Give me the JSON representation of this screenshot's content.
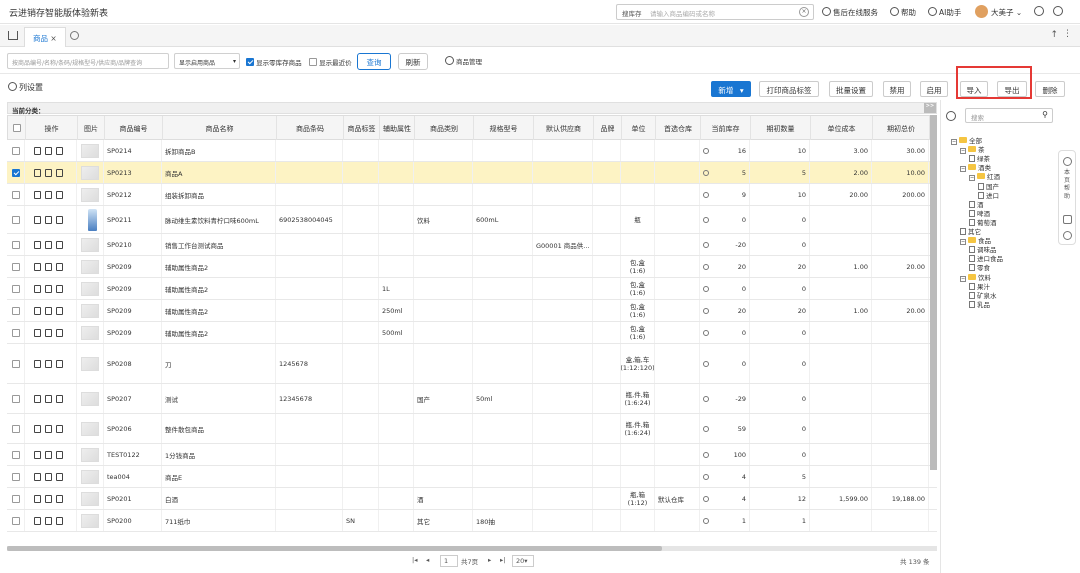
{
  "app": {
    "title": "云进销存智能版体验新表"
  },
  "search": {
    "label": "搜库存",
    "placeholder": "请输入商品编码或名称"
  },
  "topnav": {
    "service": "售后在线服务",
    "help": "帮助",
    "ai": "AI助手",
    "user": "大美子"
  },
  "tabs": [
    {
      "label": "商品"
    }
  ],
  "filter": {
    "keyword_placeholder": "按商品编号/名称/条码/规格型号/供应商/品牌查询",
    "status_select": "显示启用商品",
    "show_zero_stock": "显示零库存商品",
    "show_recent_price": "显示最近价",
    "query": "查询",
    "refresh": "刷新",
    "manage": "商品管理"
  },
  "toolbar": {
    "col_settings": "列设置",
    "new": "新增",
    "print_label": "打印商品标签",
    "batch": "批量设置",
    "disable": "禁用",
    "enable": "启用",
    "import": "导入",
    "export": "导出",
    "delete": "删除"
  },
  "category_bar": {
    "label": "当前分类：",
    "expand": ">>"
  },
  "columns": [
    "操作",
    "图片",
    "商品编号",
    "商品名称",
    "商品条码",
    "商品标签",
    "辅助属性",
    "商品类别",
    "规格型号",
    "默认供应商",
    "品牌",
    "单位",
    "首选仓库",
    "当前库存",
    "期初数量",
    "单位成本",
    "期初总价"
  ],
  "rows": [
    {
      "code": "SP0214",
      "name": "拆卸商品B",
      "barcode": "",
      "tag": "",
      "attr": "",
      "cat": "",
      "spec": "",
      "supplier": "",
      "brand": "",
      "unit": "",
      "wh": "",
      "stock": "16",
      "init": "10",
      "cost": "3.00",
      "total": "30.00"
    },
    {
      "code": "SP0213",
      "name": "商品A",
      "barcode": "",
      "tag": "",
      "attr": "",
      "cat": "",
      "spec": "",
      "supplier": "",
      "brand": "",
      "unit": "",
      "wh": "",
      "stock": "5",
      "init": "5",
      "cost": "2.00",
      "total": "10.00"
    },
    {
      "code": "SP0212",
      "name": "组装拆卸商品",
      "barcode": "",
      "tag": "",
      "attr": "",
      "cat": "",
      "spec": "",
      "supplier": "",
      "brand": "",
      "unit": "",
      "wh": "",
      "stock": "9",
      "init": "10",
      "cost": "20.00",
      "total": "200.00"
    },
    {
      "code": "SP0211",
      "name": "脉动维生素饮料青柠口味600mL",
      "barcode": "6902538004045",
      "tag": "",
      "attr": "",
      "cat": "饮料",
      "spec": "600mL",
      "supplier": "",
      "brand": "",
      "unit": "瓶",
      "wh": "",
      "stock": "0",
      "init": "0",
      "cost": "",
      "total": ""
    },
    {
      "code": "SP0210",
      "name": "销售工作台测试商品",
      "barcode": "",
      "tag": "",
      "attr": "",
      "cat": "",
      "spec": "",
      "supplier": "G00001 商品供...",
      "brand": "",
      "unit": "",
      "wh": "",
      "stock": "-20",
      "init": "0",
      "cost": "",
      "total": ""
    },
    {
      "code": "SP0209",
      "name": "辅助属性商品2",
      "barcode": "",
      "tag": "",
      "attr": "",
      "cat": "",
      "spec": "",
      "supplier": "",
      "brand": "",
      "unit": "包,盒(1:6)",
      "wh": "",
      "stock": "20",
      "init": "20",
      "cost": "1.00",
      "total": "20.00"
    },
    {
      "code": "SP0209",
      "name": "辅助属性商品2",
      "barcode": "",
      "tag": "",
      "attr": "1L",
      "cat": "",
      "spec": "",
      "supplier": "",
      "brand": "",
      "unit": "包,盒(1:6)",
      "wh": "",
      "stock": "0",
      "init": "0",
      "cost": "",
      "total": ""
    },
    {
      "code": "SP0209",
      "name": "辅助属性商品2",
      "barcode": "",
      "tag": "",
      "attr": "250ml",
      "cat": "",
      "spec": "",
      "supplier": "",
      "brand": "",
      "unit": "包,盒(1:6)",
      "wh": "",
      "stock": "20",
      "init": "20",
      "cost": "1.00",
      "total": "20.00"
    },
    {
      "code": "SP0209",
      "name": "辅助属性商品2",
      "barcode": "",
      "tag": "",
      "attr": "500ml",
      "cat": "",
      "spec": "",
      "supplier": "",
      "brand": "",
      "unit": "包,盒(1:6)",
      "wh": "",
      "stock": "0",
      "init": "0",
      "cost": "",
      "total": ""
    },
    {
      "code": "SP0208",
      "name": "刀",
      "barcode": "1245678",
      "tag": "",
      "attr": "",
      "cat": "",
      "spec": "",
      "supplier": "",
      "brand": "",
      "unit": "盒,箱,车(1:12:120)",
      "wh": "",
      "stock": "0",
      "init": "0",
      "cost": "",
      "total": ""
    },
    {
      "code": "SP0207",
      "name": "测试",
      "barcode": "12345678",
      "tag": "",
      "attr": "",
      "cat": "国产",
      "spec": "50ml",
      "supplier": "",
      "brand": "",
      "unit": "瓶,件,箱(1:6:24)",
      "wh": "",
      "stock": "-29",
      "init": "0",
      "cost": "",
      "total": ""
    },
    {
      "code": "SP0206",
      "name": "整件散包商品",
      "barcode": "",
      "tag": "",
      "attr": "",
      "cat": "",
      "spec": "",
      "supplier": "",
      "brand": "",
      "unit": "瓶,件,箱(1:6:24)",
      "wh": "",
      "stock": "59",
      "init": "0",
      "cost": "",
      "total": ""
    },
    {
      "code": "TEST0122",
      "name": "1分钱商品",
      "barcode": "",
      "tag": "",
      "attr": "",
      "cat": "",
      "spec": "",
      "supplier": "",
      "brand": "",
      "unit": "",
      "wh": "",
      "stock": "100",
      "init": "0",
      "cost": "",
      "total": ""
    },
    {
      "code": "tea004",
      "name": "商品E",
      "barcode": "",
      "tag": "",
      "attr": "",
      "cat": "",
      "spec": "",
      "supplier": "",
      "brand": "",
      "unit": "",
      "wh": "",
      "stock": "4",
      "init": "5",
      "cost": "",
      "total": ""
    },
    {
      "code": "SP0201",
      "name": "白酒",
      "barcode": "",
      "tag": "",
      "attr": "",
      "cat": "酒",
      "spec": "",
      "supplier": "",
      "brand": "",
      "unit": "瓶,箱(1:12)",
      "wh": "默认仓库",
      "stock": "4",
      "init": "12",
      "cost": "1,599.00",
      "total": "19,188.00"
    },
    {
      "code": "SP0200",
      "name": "711纸巾",
      "barcode": "",
      "tag": "SN",
      "attr": "",
      "cat": "其它",
      "spec": "180抽",
      "supplier": "",
      "brand": "",
      "unit": "",
      "wh": "",
      "stock": "1",
      "init": "1",
      "cost": "",
      "total": ""
    }
  ],
  "pager": {
    "page": "1",
    "of": "共7页",
    "size": "20",
    "total": "共 139 条"
  },
  "tree": {
    "search_placeholder": "搜索",
    "nodes": [
      {
        "label": "全部",
        "lvl": 0,
        "folder": true
      },
      {
        "label": "茶",
        "lvl": 1,
        "folder": true
      },
      {
        "label": "绿茶",
        "lvl": 2,
        "folder": false
      },
      {
        "label": "酒类",
        "lvl": 1,
        "folder": true
      },
      {
        "label": "红酒",
        "lvl": 2,
        "folder": true
      },
      {
        "label": "国产",
        "lvl": 3,
        "folder": false
      },
      {
        "label": "进口",
        "lvl": 3,
        "folder": false
      },
      {
        "label": "酒",
        "lvl": 2,
        "folder": false
      },
      {
        "label": "啤酒",
        "lvl": 2,
        "folder": false
      },
      {
        "label": "葡萄酒",
        "lvl": 2,
        "folder": false
      },
      {
        "label": "其它",
        "lvl": 1,
        "folder": false
      },
      {
        "label": "食品",
        "lvl": 1,
        "folder": true
      },
      {
        "label": "调味品",
        "lvl": 2,
        "folder": false
      },
      {
        "label": "进口食品",
        "lvl": 2,
        "folder": false
      },
      {
        "label": "零食",
        "lvl": 2,
        "folder": false
      },
      {
        "label": "饮料",
        "lvl": 1,
        "folder": true
      },
      {
        "label": "果汁",
        "lvl": 2,
        "folder": false
      },
      {
        "label": "矿泉水",
        "lvl": 2,
        "folder": false
      },
      {
        "label": "乳品",
        "lvl": 2,
        "folder": false
      }
    ]
  },
  "side_help": "本页帮助"
}
